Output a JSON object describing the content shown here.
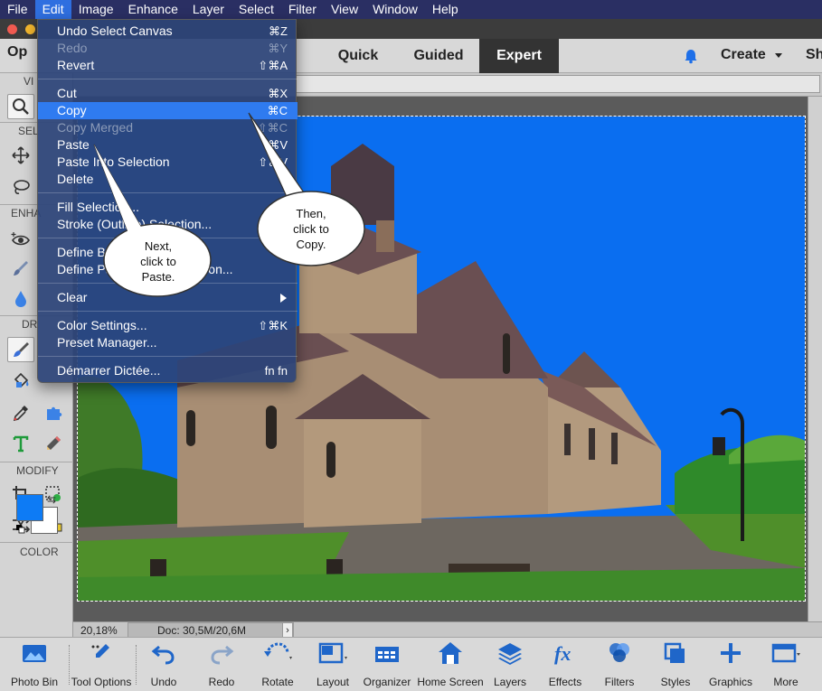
{
  "menubar": {
    "items": [
      "File",
      "Edit",
      "Image",
      "Enhance",
      "Layer",
      "Select",
      "Filter",
      "View",
      "Window",
      "Help"
    ],
    "active": "Edit"
  },
  "header": {
    "open_label": "Op",
    "modes": [
      "Quick",
      "Guided",
      "Expert"
    ],
    "active_mode": "Expert",
    "create_label": "Create",
    "share_label": "Sh"
  },
  "toolbar": {
    "sections": [
      "VI",
      "SEL",
      "ENHA",
      "DR",
      "MODIFY",
      "COLOR"
    ],
    "foreground_color": "#0d7bf5",
    "background_color": "#ffffff"
  },
  "status": {
    "zoom": "20,18%",
    "doc": "Doc: 30,5M/20,6M",
    "arrow": "›"
  },
  "bottombar": {
    "items": [
      "Photo Bin",
      "Tool Options",
      "Undo",
      "Redo",
      "Rotate",
      "Layout",
      "Organizer",
      "Home Screen",
      "Layers",
      "Effects",
      "Filters",
      "Styles",
      "Graphics",
      "More"
    ]
  },
  "edit_menu": {
    "items": [
      {
        "label": "Undo Select Canvas",
        "shortcut": "⌘Z",
        "disabled": false
      },
      {
        "label": "Redo",
        "shortcut": "⌘Y",
        "disabled": true
      },
      {
        "label": "Revert",
        "shortcut": "⇧⌘A",
        "disabled": false
      },
      {
        "label": "Cut",
        "shortcut": "⌘X",
        "disabled": false
      },
      {
        "label": "Copy",
        "shortcut": "⌘C",
        "disabled": false,
        "highlighted": true
      },
      {
        "label": "Copy Merged",
        "shortcut": "⇧⌘C",
        "disabled": true
      },
      {
        "label": "Paste",
        "shortcut": "⌘V",
        "disabled": false
      },
      {
        "label": "Paste Into Selection",
        "shortcut": "⇧⌘V",
        "disabled": false
      },
      {
        "label": "Delete",
        "shortcut": "",
        "disabled": false
      },
      {
        "label": "Fill Selection...",
        "shortcut": "",
        "disabled": false
      },
      {
        "label": "Stroke (Outline) Selection...",
        "shortcut": "",
        "disabled": false
      },
      {
        "label": "Define Brush...",
        "shortcut": "",
        "disabled": false
      },
      {
        "label": "Define Pattern from Selection...",
        "shortcut": "",
        "disabled": false
      },
      {
        "label": "Clear",
        "shortcut": "",
        "disabled": false,
        "submenu": true
      },
      {
        "label": "Color Settings...",
        "shortcut": "⇧⌘K",
        "disabled": false
      },
      {
        "label": "Preset Manager...",
        "shortcut": "",
        "disabled": false
      },
      {
        "label": "Démarrer Dictée...",
        "shortcut": "fn fn",
        "disabled": false
      }
    ]
  },
  "callouts": {
    "next": "Next,\nclick to\nPaste.",
    "then": "Then,\nclick to\nCopy."
  },
  "colors": {
    "menubar_bg": "#2a2f63",
    "menu_highlight": "#2f7bf0",
    "sky": "#0a6ef0",
    "active_mode_bg": "#333333"
  }
}
